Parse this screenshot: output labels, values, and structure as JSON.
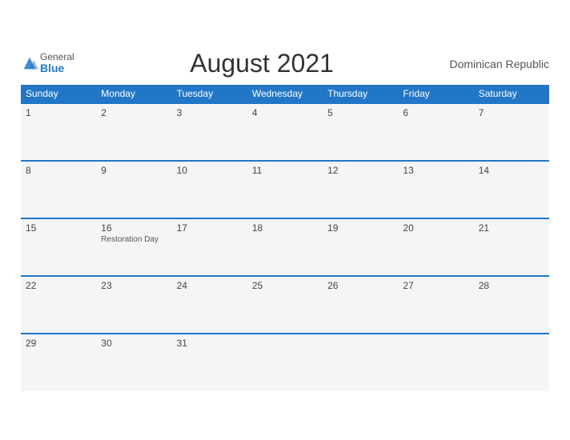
{
  "header": {
    "title": "August 2021",
    "country": "Dominican Republic",
    "logo_general": "General",
    "logo_blue": "Blue"
  },
  "weekdays": [
    "Sunday",
    "Monday",
    "Tuesday",
    "Wednesday",
    "Thursday",
    "Friday",
    "Saturday"
  ],
  "weeks": [
    [
      {
        "day": "1",
        "holiday": ""
      },
      {
        "day": "2",
        "holiday": ""
      },
      {
        "day": "3",
        "holiday": ""
      },
      {
        "day": "4",
        "holiday": ""
      },
      {
        "day": "5",
        "holiday": ""
      },
      {
        "day": "6",
        "holiday": ""
      },
      {
        "day": "7",
        "holiday": ""
      }
    ],
    [
      {
        "day": "8",
        "holiday": ""
      },
      {
        "day": "9",
        "holiday": ""
      },
      {
        "day": "10",
        "holiday": ""
      },
      {
        "day": "11",
        "holiday": ""
      },
      {
        "day": "12",
        "holiday": ""
      },
      {
        "day": "13",
        "holiday": ""
      },
      {
        "day": "14",
        "holiday": ""
      }
    ],
    [
      {
        "day": "15",
        "holiday": ""
      },
      {
        "day": "16",
        "holiday": "Restoration Day"
      },
      {
        "day": "17",
        "holiday": ""
      },
      {
        "day": "18",
        "holiday": ""
      },
      {
        "day": "19",
        "holiday": ""
      },
      {
        "day": "20",
        "holiday": ""
      },
      {
        "day": "21",
        "holiday": ""
      }
    ],
    [
      {
        "day": "22",
        "holiday": ""
      },
      {
        "day": "23",
        "holiday": ""
      },
      {
        "day": "24",
        "holiday": ""
      },
      {
        "day": "25",
        "holiday": ""
      },
      {
        "day": "26",
        "holiday": ""
      },
      {
        "day": "27",
        "holiday": ""
      },
      {
        "day": "28",
        "holiday": ""
      }
    ],
    [
      {
        "day": "29",
        "holiday": ""
      },
      {
        "day": "30",
        "holiday": ""
      },
      {
        "day": "31",
        "holiday": ""
      },
      {
        "day": "",
        "holiday": ""
      },
      {
        "day": "",
        "holiday": ""
      },
      {
        "day": "",
        "holiday": ""
      },
      {
        "day": "",
        "holiday": ""
      }
    ]
  ]
}
